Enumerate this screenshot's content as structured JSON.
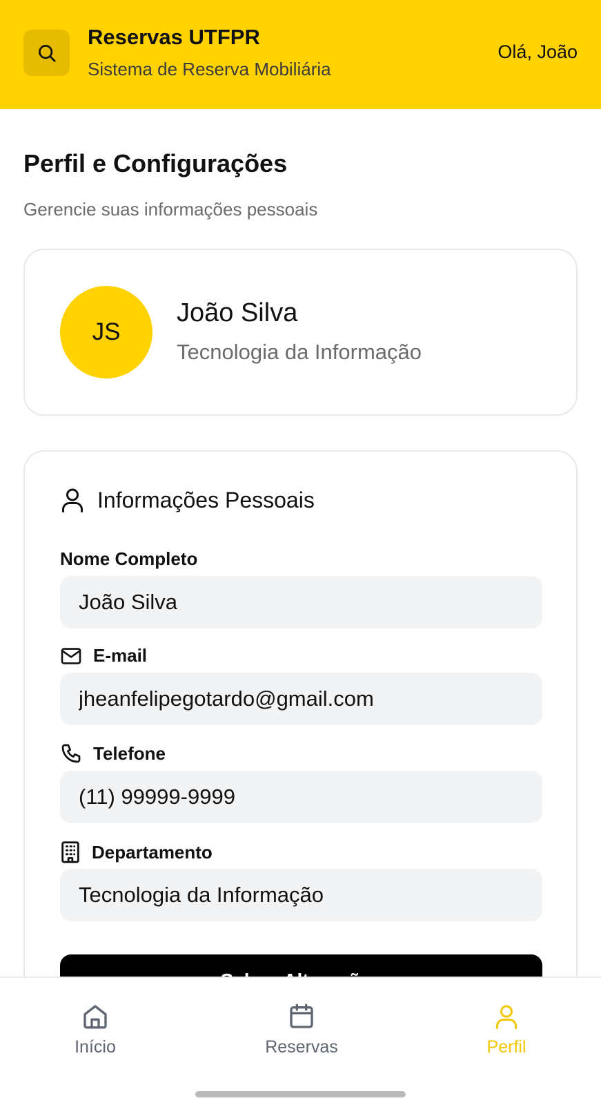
{
  "header": {
    "title": "Reservas UTFPR",
    "subtitle": "Sistema de Reserva Mobiliária",
    "greeting": "Olá, João",
    "accent_color": "#FFD200"
  },
  "page": {
    "title": "Perfil e Configurações",
    "subtitle": "Gerencie suas informações pessoais"
  },
  "profile": {
    "initials": "JS",
    "name": "João Silva",
    "department": "Tecnologia da Informação"
  },
  "personal_info": {
    "title": "Informações Pessoais",
    "icon": "user-icon",
    "fields": {
      "name": {
        "label": "Nome Completo",
        "value": "João Silva"
      },
      "email": {
        "label": "E-mail",
        "value": "jheanfelipegotardo@gmail.com",
        "icon": "mail-icon"
      },
      "phone": {
        "label": "Telefone",
        "value": "(11) 99999-9999",
        "icon": "phone-icon"
      },
      "department": {
        "label": "Departamento",
        "value": "Tecnologia da Informação",
        "icon": "building-icon"
      }
    },
    "save_label": "Salvar Alterações"
  },
  "nav": {
    "items": [
      {
        "label": "Início",
        "icon": "home-icon",
        "active": false
      },
      {
        "label": "Reservas",
        "icon": "calendar-icon",
        "active": false
      },
      {
        "label": "Perfil",
        "icon": "user-icon",
        "active": true
      }
    ],
    "active_color": "#F2C600"
  }
}
